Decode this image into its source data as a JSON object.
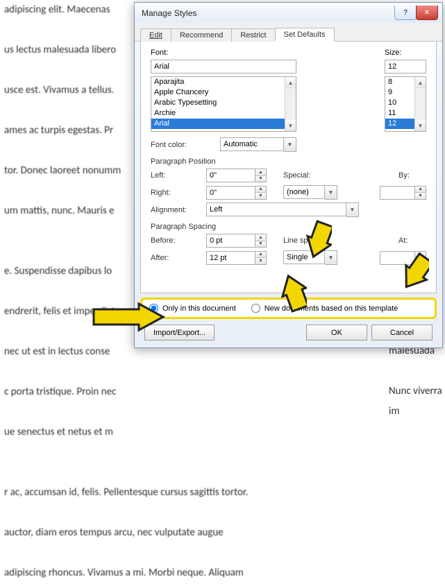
{
  "bg": {
    "para1": "adipiscing elit. Maecenas\n\nus lectus malesuada libero\n\nusce est. Vivamus a tellus.\n\names ac turpis egestas. Pr\n\ntor. Donec laoreet nonumm\n\num mattis, nunc. Mauris e\n\n\ne. Suspendisse dapibus lo\n\nendrerit, felis et imperdiet\n\nnec ut est in lectus conse\n\nc porta tristique. Proin nec\n\nue senectus et netus et m\n\n\nr ac, accumsan id, felis. Pellentesque cursus sagittis tortor.\n\nauctor, diam eros tempus arcu, nec vulputate augue\n\nadipiscing rhoncus. Vivamus a mi. Morbi neque. Aliquam",
    "right1": "Nunc viverra im",
    "right2": "malesuada"
  },
  "dialog": {
    "title": "Manage Styles",
    "close": "✕",
    "help": "?",
    "tabs": {
      "edit": "Edit",
      "recommend": "Recommend",
      "restrict": "Restrict",
      "defaults": "Set Defaults"
    }
  },
  "labels": {
    "font": "Font:",
    "size": "Size:",
    "fontcolor": "Font color:",
    "parapos": "Paragraph Position",
    "left": "Left:",
    "right": "Right:",
    "alignment": "Alignment:",
    "special": "Special:",
    "by": "By:",
    "paraspacing": "Paragraph Spacing",
    "before": "Before:",
    "after": "After:",
    "linespacing": "Line spacing:",
    "at": "At:"
  },
  "values": {
    "font_input": "Arial",
    "font_list": [
      "Aparajita",
      "Apple Chancery",
      "Arabic Typesetting",
      "Archie",
      "Arial"
    ],
    "size_input": "12",
    "size_list": [
      "8",
      "9",
      "10",
      "11",
      "12"
    ],
    "fontcolor_sel": "Automatic",
    "left": "0\"",
    "right": "0\"",
    "alignment_sel": "Left",
    "special_sel": "(none)",
    "by": "",
    "before": "0 pt",
    "after": "12 pt",
    "linespacing_sel": "Single",
    "at": ""
  },
  "radios": {
    "only": "Only in this document",
    "new": "New documents based on this template"
  },
  "buttons": {
    "import": "Import/Export...",
    "ok": "OK",
    "cancel": "Cancel"
  }
}
